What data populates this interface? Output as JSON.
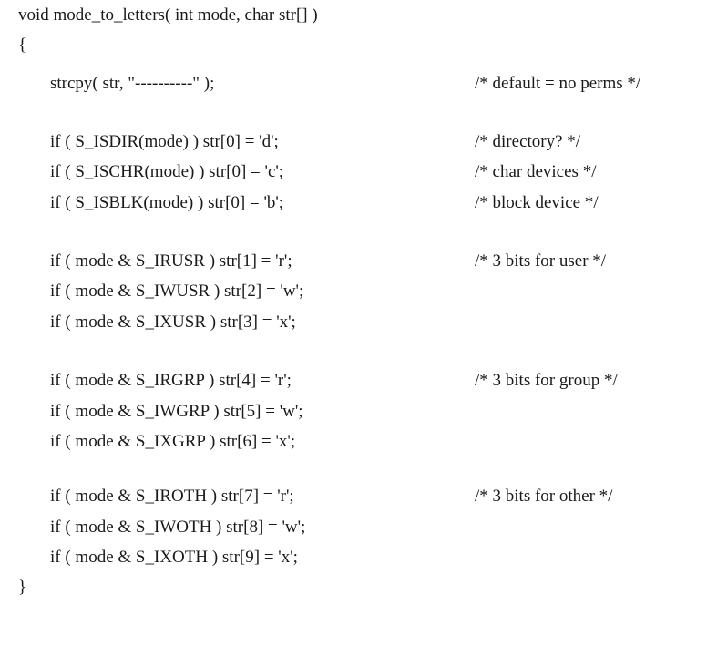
{
  "code_listing": {
    "lines": [
      {
        "code": "void mode_to_letters( int mode, char str[] )",
        "comment": ""
      },
      {
        "code": "{",
        "comment": ""
      },
      {
        "code": "strcpy( str, \"----------\" );",
        "comment": "/* default = no perms */"
      },
      {
        "code": "if ( S_ISDIR(mode) ) str[0] = 'd';",
        "comment": "/* directory? */"
      },
      {
        "code": "if ( S_ISCHR(mode) ) str[0] = 'c';",
        "comment": "/* char devices */"
      },
      {
        "code": "if ( S_ISBLK(mode) ) str[0] = 'b';",
        "comment": "/* block device */"
      },
      {
        "code": "if ( mode & S_IRUSR ) str[1] = 'r';",
        "comment": "/* 3 bits for user */"
      },
      {
        "code": "if ( mode & S_IWUSR ) str[2] = 'w';",
        "comment": ""
      },
      {
        "code": "if ( mode & S_IXUSR ) str[3] = 'x';",
        "comment": ""
      },
      {
        "code": "if ( mode & S_IRGRP ) str[4] = 'r';",
        "comment": "/* 3 bits for group */"
      },
      {
        "code": "if ( mode & S_IWGRP ) str[5] = 'w';",
        "comment": ""
      },
      {
        "code": "if ( mode & S_IXGRP ) str[6] = 'x';",
        "comment": ""
      },
      {
        "code": "if ( mode & S_IROTH ) str[7] = 'r';",
        "comment": "/* 3 bits for other */"
      },
      {
        "code": "if ( mode & S_IWOTH ) str[8] = 'w';",
        "comment": ""
      },
      {
        "code": "if ( mode & S_IXOTH ) str[9] = 'x';",
        "comment": ""
      },
      {
        "code": "}",
        "comment": ""
      }
    ]
  }
}
